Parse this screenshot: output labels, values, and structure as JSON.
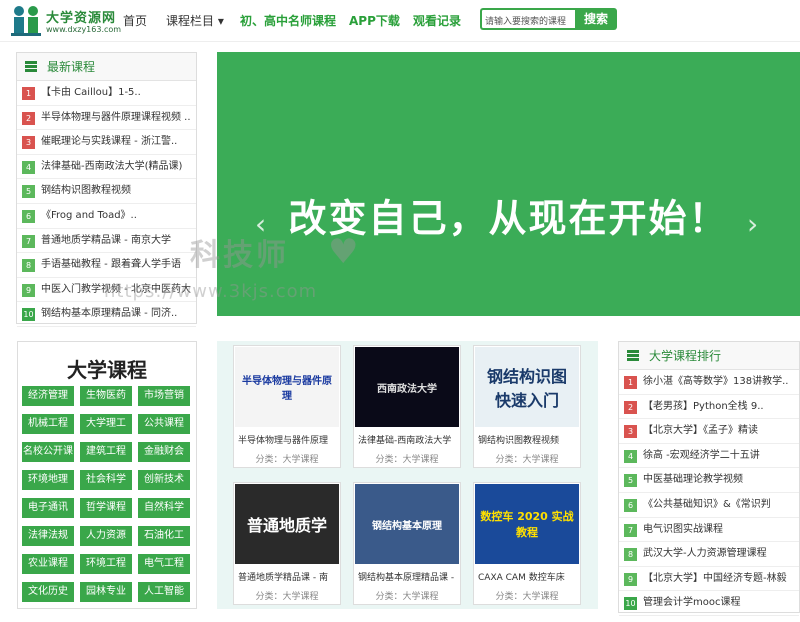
{
  "header": {
    "logo_title": "大学资源网",
    "logo_url": "www.dxzy163.com",
    "nav": [
      {
        "label": "首页",
        "green": false
      },
      {
        "label": "课程栏目 ▾",
        "green": false
      },
      {
        "label": "初、高中名师课程",
        "green": true
      },
      {
        "label": "APP下载",
        "green": true
      },
      {
        "label": "观看记录",
        "green": true
      }
    ],
    "search_placeholder": "请输入要搜索的课程",
    "search_button": "搜索"
  },
  "latest": {
    "title": "最新课程",
    "items": [
      "【卡由 Caillou】1-5..",
      "半导体物理与器件原理课程视频 ..",
      "催眠理论与实践课程 - 浙江警..",
      "法律基础-西南政法大学(精品课)",
      "钢结构识图教程视频",
      "《Frog and Toad》..",
      "普通地质学精品课 - 南京大学",
      "手语基础教程 - 跟着聋人学手语",
      "中医入门教学视频 - 北京中医药大",
      "钢结构基本原理精品课 - 同济.."
    ]
  },
  "banner": {
    "text": "改变自己，从现在开始！",
    "prev": "‹",
    "next": "›",
    "active_slide": 3,
    "total_slides": 3
  },
  "watermark": {
    "line1": "科技师",
    "line2": "https://www.3kjs.com"
  },
  "categories": {
    "title": "大学课程",
    "items": [
      "经济管理",
      "生物医药",
      "市场营销",
      "机械工程",
      "大学理工",
      "公共课程",
      "名校公开课",
      "建筑工程",
      "金融财会",
      "环境地理",
      "社会科学",
      "创新技术",
      "电子通讯",
      "哲学课程",
      "自然科学",
      "法律法规",
      "人力资源",
      "石油化工",
      "农业课程",
      "环境工程",
      "电气工程",
      "文化历史",
      "园林专业",
      "人工智能"
    ]
  },
  "courses": [
    {
      "title": "半导体物理与器件原理",
      "sub": "分类：大学课程",
      "thumb_text": "半导体物理与器件原理"
    },
    {
      "title": "法律基础-西南政法大学",
      "sub": "分类：大学课程",
      "thumb_text": "西南政法大学"
    },
    {
      "title": "钢结构识图教程视频",
      "sub": "分类：大学课程",
      "thumb_text": "钢结构识图\n快速入门"
    },
    {
      "title": "普通地质学精品课 - 南",
      "sub": "分类：大学课程",
      "thumb_text": "普通地质学"
    },
    {
      "title": "钢结构基本原理精品课 -",
      "sub": "分类：大学课程",
      "thumb_text": "钢结构基本原理"
    },
    {
      "title": "CAXA CAM 数控车床",
      "sub": "分类：大学课程",
      "thumb_text": "数控车 2020 实战教程"
    }
  ],
  "ranking": {
    "title": "大学课程排行",
    "items": [
      "徐小湛《高等数学》138讲教学..",
      "【老男孩】Python全栈 9..",
      "【北京大学】《孟子》精读",
      "徐高 -宏观经济学二十五讲",
      "中医基础理论教学视频",
      "《公共基础知识》&《常识判",
      "电气识图实战课程",
      "武汉大学-人力资源管理课程",
      "【北京大学】中国经济专题-林毅",
      "管理会计学mooc课程"
    ]
  },
  "colors": {
    "green": "#3aa74a",
    "banner": "#3bac57",
    "rank_top": "#d9534f",
    "rank_rest": "#5cb85c",
    "rank_ten": "#3aa74a"
  }
}
